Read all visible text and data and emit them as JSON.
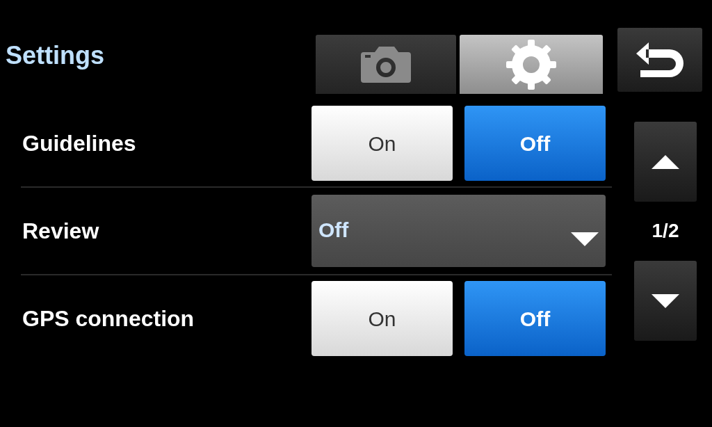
{
  "title": "Settings",
  "tabs": [
    {
      "kind": "camera",
      "selected": false
    },
    {
      "kind": "settings",
      "selected": true
    }
  ],
  "settings": [
    {
      "label": "Guidelines",
      "kind": "toggle",
      "options": [
        {
          "label": "On",
          "selected": false
        },
        {
          "label": "Off",
          "selected": true
        }
      ]
    },
    {
      "label": "Review",
      "kind": "dropdown",
      "value": "Off"
    },
    {
      "label": "GPS connection",
      "kind": "toggle",
      "options": [
        {
          "label": "On",
          "selected": false
        },
        {
          "label": "Off",
          "selected": true
        }
      ]
    }
  ],
  "page": "1/2"
}
